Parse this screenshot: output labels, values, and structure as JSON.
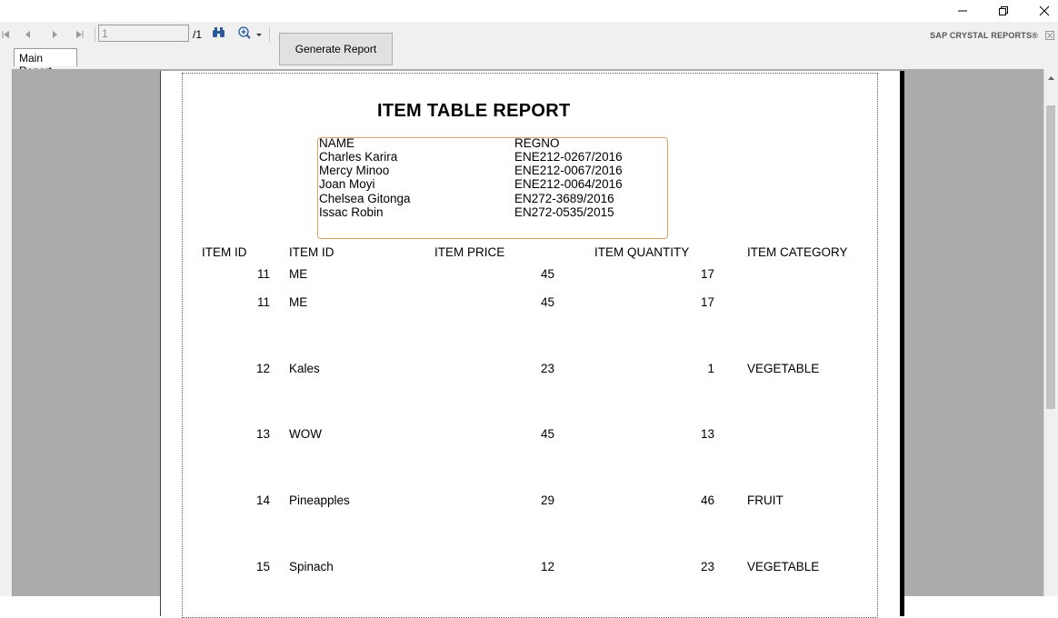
{
  "window": {
    "controls": [
      "minimize",
      "restore",
      "close"
    ]
  },
  "toolbar": {
    "page_value": "1",
    "page_total": "/1",
    "generate_label": "Generate Report",
    "brand": "SAP CRYSTAL REPORTS®"
  },
  "tabs": [
    {
      "label": "Main Report"
    }
  ],
  "report": {
    "title": "ITEM TABLE REPORT",
    "names_header": {
      "name": "NAME",
      "regno": "REGNO"
    },
    "members": [
      {
        "name": "Charles Karira",
        "regno": "ENE212-0267/2016"
      },
      {
        "name": "Mercy Minoo",
        "regno": "ENE212-0067/2016"
      },
      {
        "name": "Joan Moyi",
        "regno": "ENE212-0064/2016"
      },
      {
        "name": "Chelsea Gitonga",
        "regno": "EN272-3689/2016"
      },
      {
        "name": "Issac Robin",
        "regno": "EN272-0535/2015"
      }
    ],
    "columns": [
      "ITEM ID",
      "ITEM ID",
      "ITEM PRICE",
      "ITEM QUANTITY",
      "ITEM CATEGORY"
    ],
    "rows": [
      {
        "id": "11",
        "name": "ME",
        "price": "45",
        "qty": "17",
        "category": ""
      },
      {
        "id": "11",
        "name": "ME",
        "price": "45",
        "qty": "17",
        "category": ""
      },
      {
        "id": "12",
        "name": "Kales",
        "price": "23",
        "qty": "1",
        "category": "VEGETABLE"
      },
      {
        "id": "13",
        "name": "WOW",
        "price": "45",
        "qty": "13",
        "category": ""
      },
      {
        "id": "14",
        "name": "Pineapples",
        "price": "29",
        "qty": "46",
        "category": "FRUIT"
      },
      {
        "id": "15",
        "name": "Spinach",
        "price": "12",
        "qty": "23",
        "category": "VEGETABLE"
      }
    ]
  }
}
